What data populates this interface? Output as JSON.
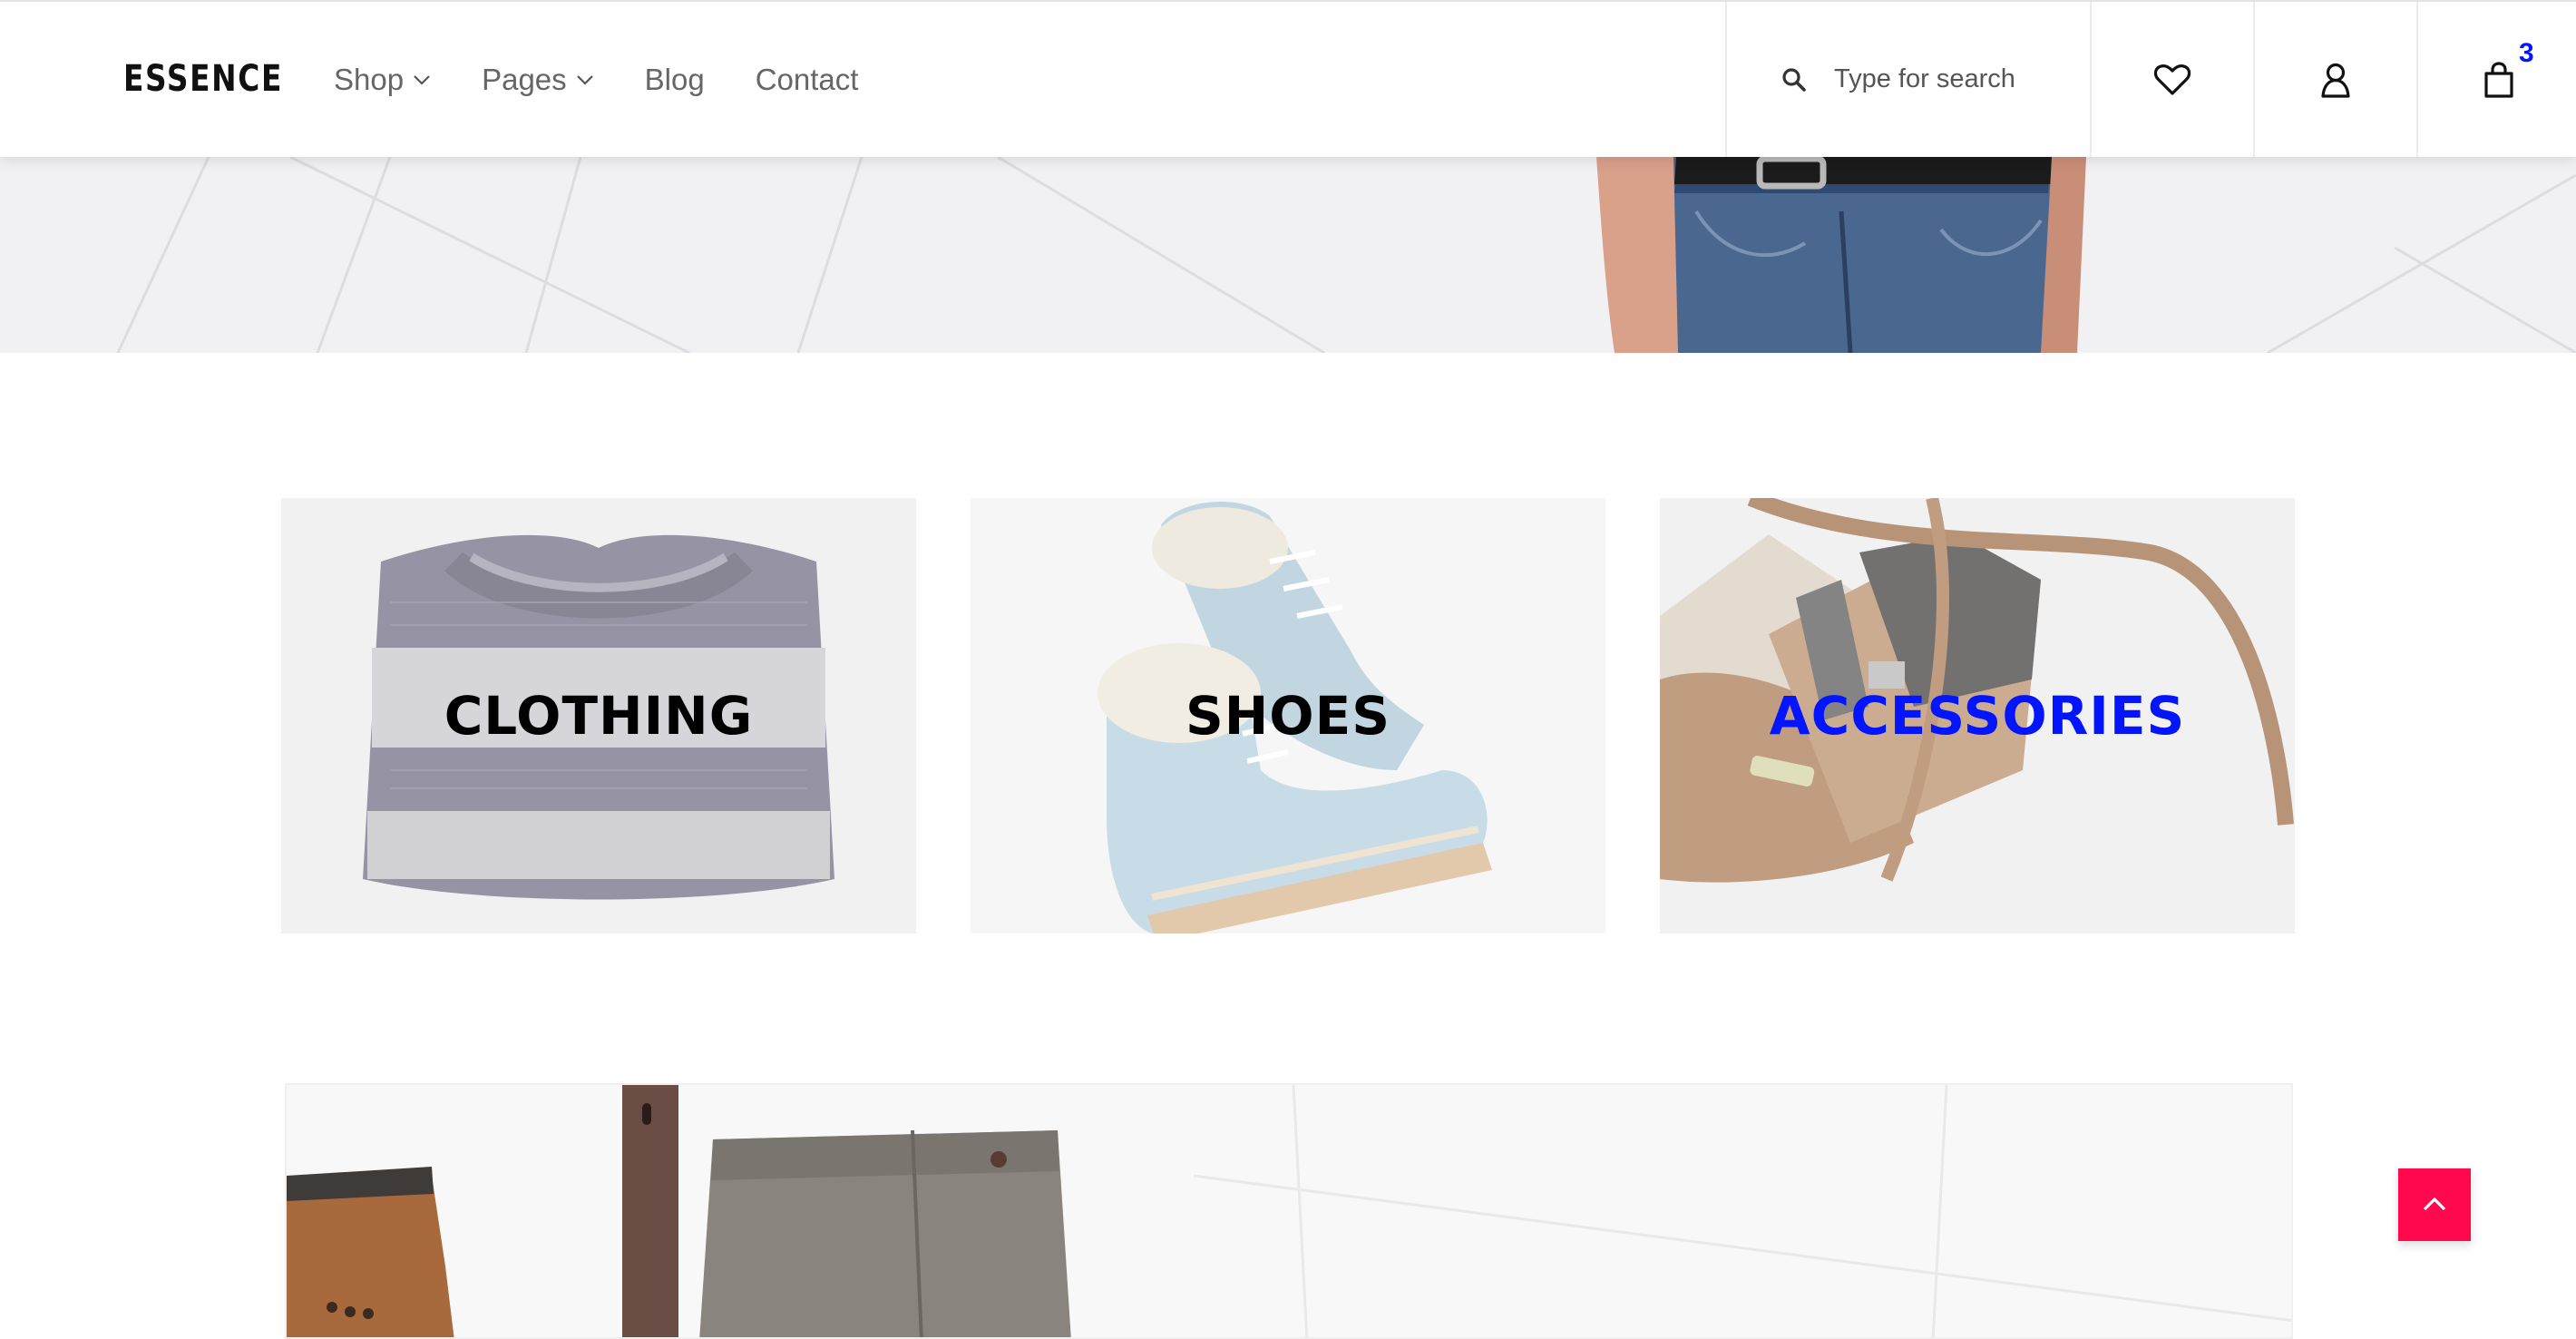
{
  "brand": {
    "logo_text": "ESSENCE"
  },
  "nav": {
    "items": [
      {
        "label": "Shop",
        "has_dropdown": true
      },
      {
        "label": "Pages",
        "has_dropdown": true
      },
      {
        "label": "Blog",
        "has_dropdown": false
      },
      {
        "label": "Contact",
        "has_dropdown": false
      }
    ]
  },
  "search": {
    "placeholder": "Type for search",
    "value": ""
  },
  "header_icons": {
    "favorites": "heart-icon",
    "account": "user-icon",
    "cart": "shopping-bag-icon",
    "cart_count": "3"
  },
  "categories": [
    {
      "label": "CLOTHING",
      "image": "knit-sweater-image",
      "active": false
    },
    {
      "label": "SHOES",
      "image": "winter-boots-image",
      "active": false
    },
    {
      "label": "ACCESSORIES",
      "image": "leather-bag-image",
      "active": true
    }
  ],
  "colors": {
    "accent_blue": "#0315ff",
    "scroll_top_bg": "#ff084e",
    "nav_text": "#666666"
  },
  "scroll_top": {
    "icon": "chevron-up-icon"
  }
}
